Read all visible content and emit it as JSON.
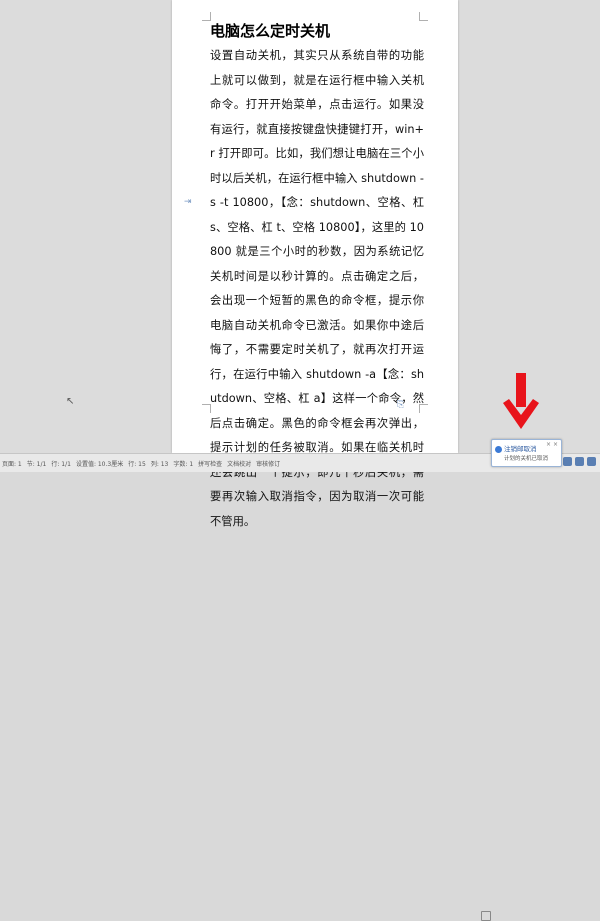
{
  "document": {
    "title": "电脑怎么定时关机",
    "body": "设置自动关机，其实只从系统自带的功能上就可以做到，就是在运行框中输入关机命令。打开开始菜单，点击运行。如果没有运行，就直接按键盘快捷键打开，win+r 打开即可。比如，我们想让电脑在三个小时以后关机，在运行框中输入 shutdown -s -t 10800，【念：shutdown、空格、杠 s、空格、杠 t、空格 10800】，这里的 10800 就是三个小时的秒数，因为系统记忆关机时间是以秒计算的。点击确定之后，会出现一个短暂的黑色的命令框，提示你电脑自动关机命令已激活。如果你中途后悔了，不需要定时关机了，就再次打开运行，在运行中输入 shutdown -a【念：shutdown、空格、杠 a】这样一个命令，然后点击确定。黑色的命令框会再次弹出，提示计划的任务被取消。如果在临关机时还会跳出一个提示，即几十秒后关机，需要再次输入取消指令，因为取消一次可能不管用。"
  },
  "statusbar": {
    "items": [
      "页面: 1",
      "节: 1/1",
      "行: 1/1",
      "设置值: 10.3厘米",
      "行: 15",
      "列: 13",
      "字数: 1",
      "拼写检查",
      "文档校对",
      "审核修订"
    ]
  },
  "notification": {
    "title": "注销邮取消",
    "subtitle": "计划的关机已取消"
  },
  "colors": {
    "arrow": "#e8141b",
    "accent": "#2c5aa0"
  }
}
